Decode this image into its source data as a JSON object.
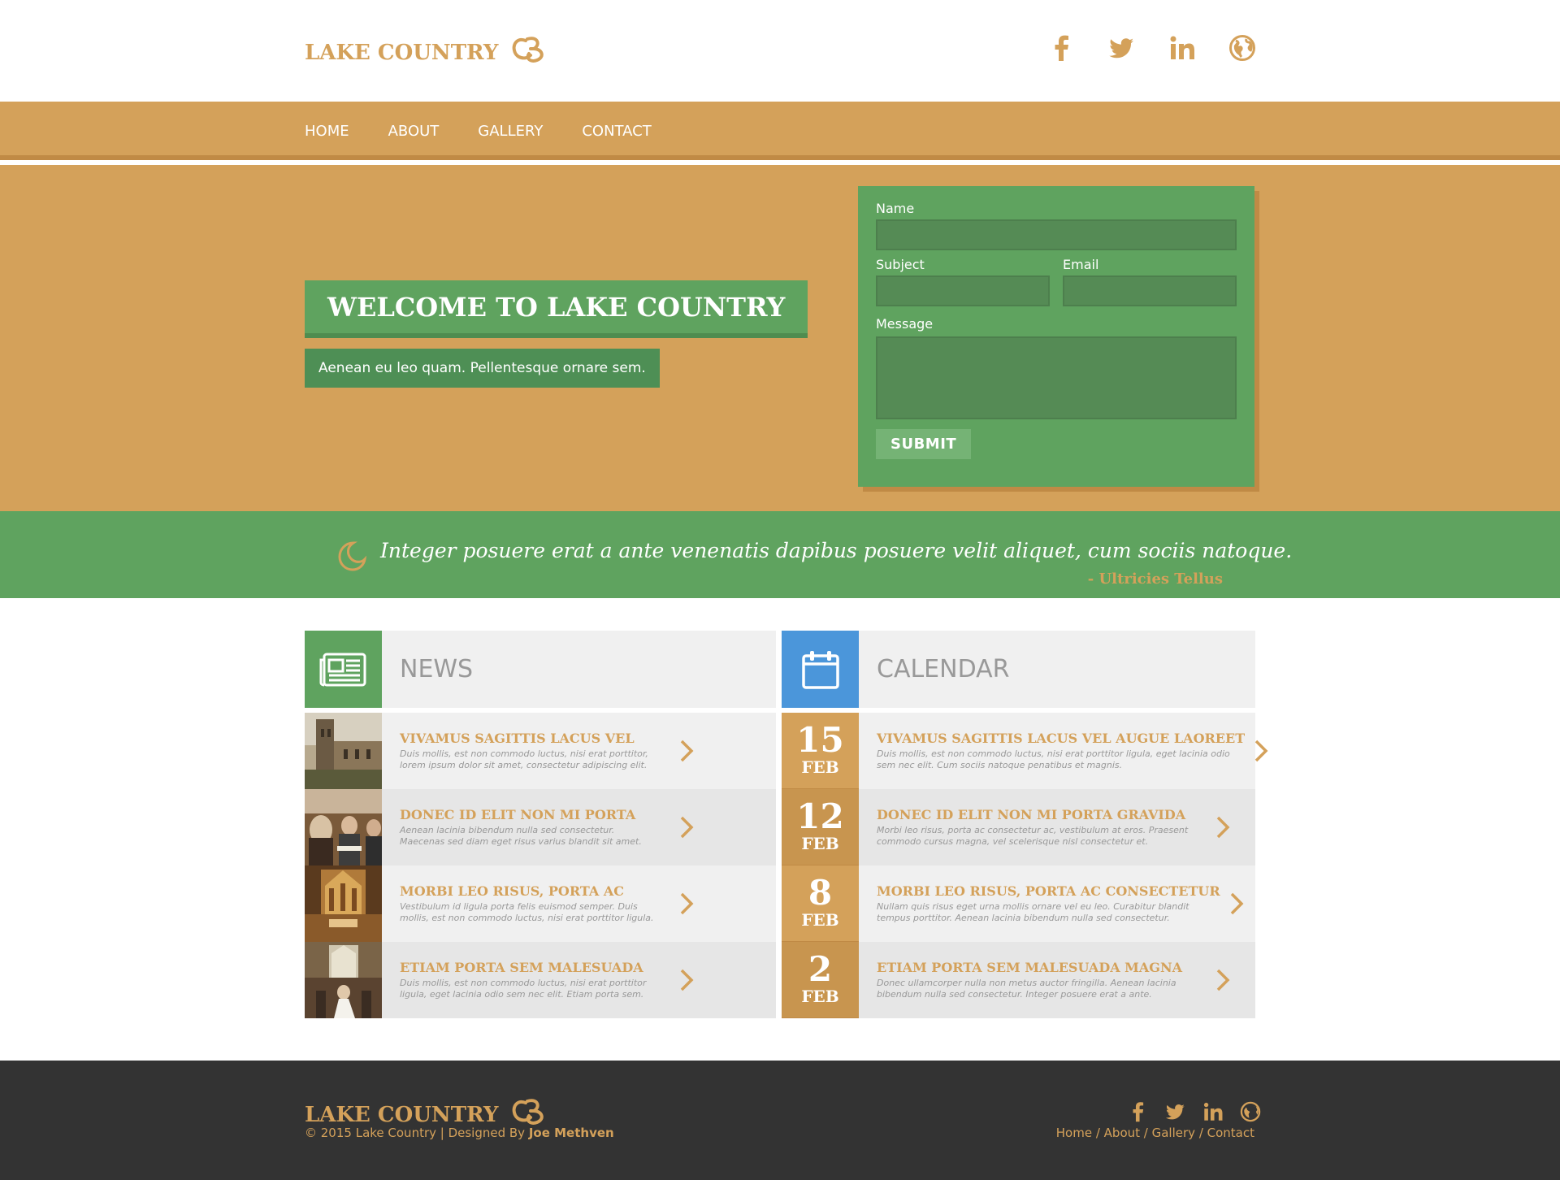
{
  "brand": {
    "name": "LAKE COUNTRY",
    "mark": "CB"
  },
  "colors": {
    "accent": "#d4a15a",
    "green": "#5fa35f",
    "blue": "#4b96da",
    "footer": "#333333"
  },
  "header": {
    "social_icons": [
      "facebook-icon",
      "twitter-icon",
      "linkedin-icon",
      "globe-icon"
    ]
  },
  "nav": {
    "items": [
      "HOME",
      "ABOUT",
      "GALLERY",
      "CONTACT"
    ]
  },
  "hero": {
    "title": "WELCOME TO LAKE COUNTRY",
    "subtitle": "Aenean eu leo quam. Pellentesque ornare sem."
  },
  "form": {
    "name_label": "Name",
    "subject_label": "Subject",
    "email_label": "Email",
    "message_label": "Message",
    "submit_label": "SUBMIT"
  },
  "quote": {
    "text": "Integer posuere erat a ante venenatis dapibus posuere velit aliquet, cum sociis natoque.",
    "author": "- Ultricies Tellus"
  },
  "news": {
    "title": "NEWS",
    "items": [
      {
        "title": "VIVAMUS SAGITTIS LACUS VEL",
        "desc": "Duis mollis, est non commodo luctus, nisi erat porttitor, lorem ipsum dolor sit amet, consectetur adipiscing elit."
      },
      {
        "title": "DONEC ID ELIT NON MI PORTA",
        "desc": "Aenean lacinia bibendum nulla sed consectetur. Maecenas sed diam eget risus varius blandit sit amet."
      },
      {
        "title": "MORBI LEO RISUS, PORTA AC",
        "desc": "Vestibulum id ligula porta felis euismod semper. Duis mollis, est non commodo luctus, nisi erat porttitor ligula."
      },
      {
        "title": "ETIAM PORTA SEM MALESUADA",
        "desc": "Duis mollis, est non commodo luctus, nisi erat porttitor ligula, eget lacinia odio sem nec elit. Etiam porta sem."
      }
    ]
  },
  "calendar": {
    "title": "CALENDAR",
    "items": [
      {
        "day": "15",
        "month": "FEB",
        "title": "VIVAMUS SAGITTIS LACUS VEL AUGUE LAOREET",
        "desc": "Duis mollis, est non commodo luctus, nisi erat porttitor ligula, eget lacinia odio sem nec elit. Cum sociis natoque penatibus et magnis."
      },
      {
        "day": "12",
        "month": "FEB",
        "title": "DONEC ID ELIT NON MI PORTA GRAVIDA",
        "desc": "Morbi leo risus, porta ac consectetur ac, vestibulum at eros. Praesent commodo cursus magna, vel scelerisque nisl consectetur et."
      },
      {
        "day": "8",
        "month": "FEB",
        "title": "MORBI LEO RISUS, PORTA AC CONSECTETUR",
        "desc": "Nullam quis risus eget urna mollis ornare vel eu leo. Curabitur blandit tempus porttitor. Aenean lacinia bibendum nulla sed consectetur."
      },
      {
        "day": "2",
        "month": "FEB",
        "title": "ETIAM PORTA SEM MALESUADA MAGNA",
        "desc": "Donec ullamcorper nulla non metus auctor fringilla. Aenean lacinia bibendum nulla sed consectetur. Integer posuere erat a ante."
      }
    ]
  },
  "footer": {
    "copyright": "© 2015 Lake Country | Designed By",
    "designer": "Joe Methven",
    "links": [
      "Home",
      "About",
      "Gallery",
      "Contact"
    ],
    "separator": " / "
  }
}
